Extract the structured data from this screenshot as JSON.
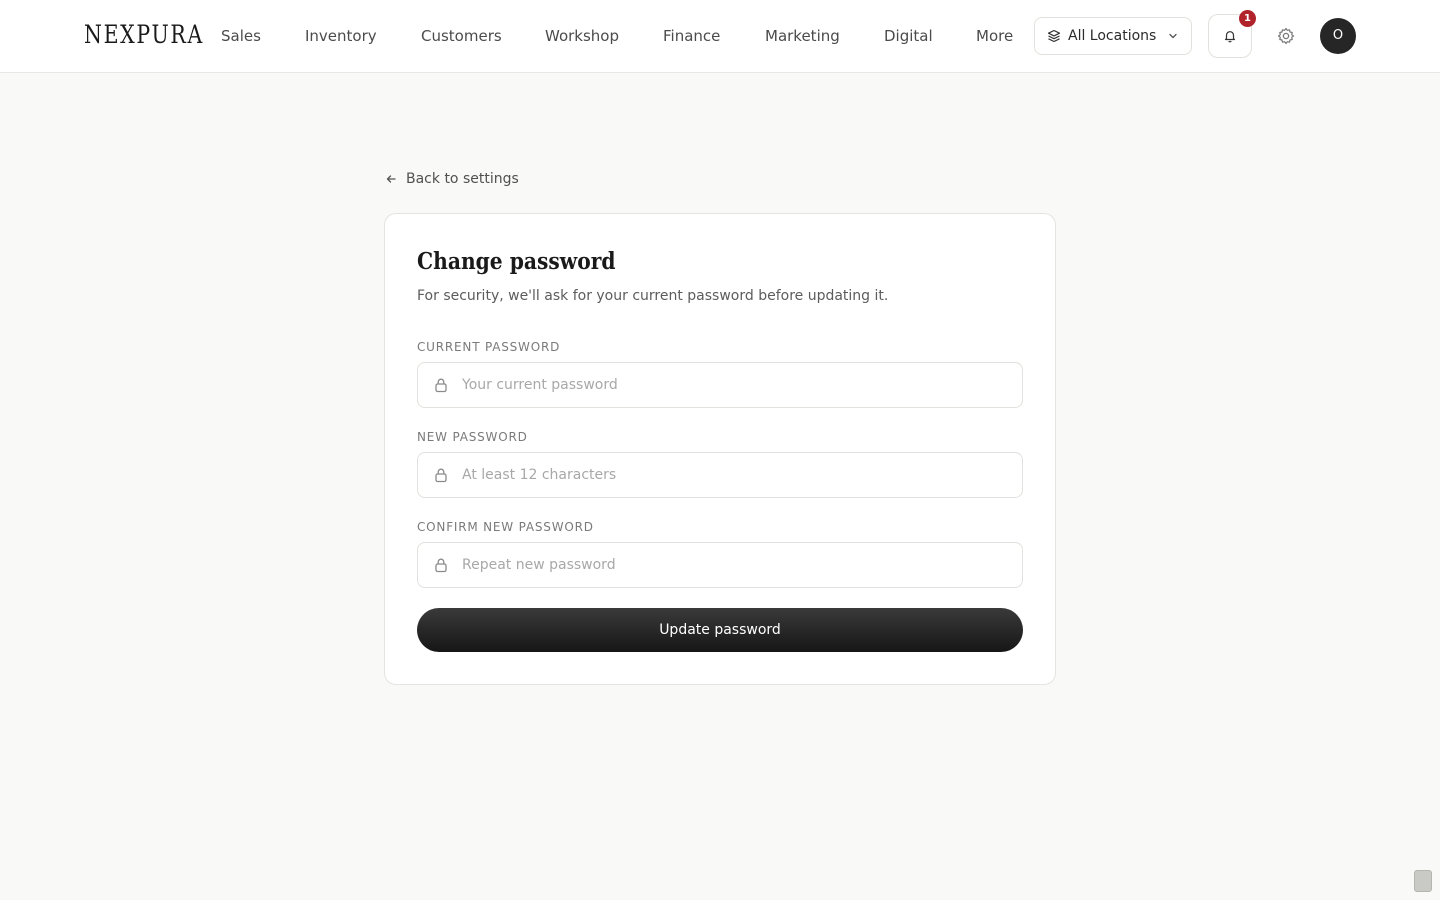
{
  "header": {
    "logo": "NEXPURA",
    "nav": [
      {
        "label": "Sales",
        "icon": null
      },
      {
        "label": "Inventory"
      },
      {
        "label": "Customers"
      },
      {
        "label": "Workshop"
      },
      {
        "label": "Finance"
      },
      {
        "label": "Marketing"
      },
      {
        "label": "Digital"
      },
      {
        "label": "More"
      }
    ],
    "location_selector": {
      "label": "All Locations",
      "icon": "layers-icon"
    },
    "notifications": {
      "count": "1",
      "icon": "bell-icon"
    },
    "settings_icon": "gear-icon",
    "avatar_initial": "O"
  },
  "back_link": {
    "label": "Back to settings",
    "icon": "arrow-left-icon"
  },
  "form": {
    "title": "Change password",
    "subtitle": "For security, we'll ask for your current password before updating it.",
    "fields": [
      {
        "label": "CURRENT PASSWORD",
        "placeholder": "Your current password",
        "value": ""
      },
      {
        "label": "NEW PASSWORD",
        "placeholder": "At least 12 characters",
        "value": ""
      },
      {
        "label": "CONFIRM NEW PASSWORD",
        "placeholder": "Repeat new password",
        "value": ""
      }
    ],
    "submit_label": "Update password"
  },
  "colors": {
    "background": "#f9f9f8",
    "badge": "#b0232a",
    "primary_button": "#1e1e1e"
  }
}
